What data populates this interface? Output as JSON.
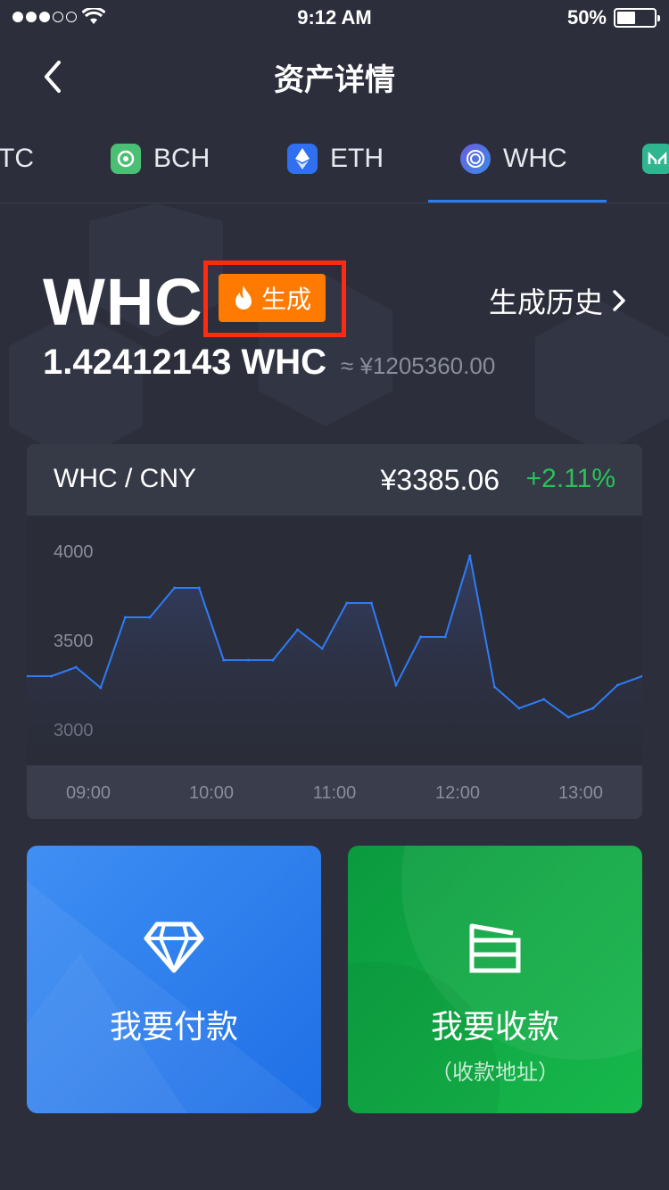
{
  "status_bar": {
    "time": "9:12 AM",
    "battery_percent": "50%",
    "battery_level": 0.5,
    "signal_bars_filled": 3,
    "signal_bars_total": 5
  },
  "nav": {
    "title": "资产详情",
    "back_icon": "chevron-left-icon"
  },
  "coin_tabs": [
    {
      "label": "TC",
      "active": false
    },
    {
      "label": "BCH",
      "active": false,
      "icon": "bch-coin-icon",
      "color": "#4bbf73"
    },
    {
      "label": "ETH",
      "active": false,
      "icon": "eth-coin-icon",
      "color": "#2f6ff0"
    },
    {
      "label": "WHC",
      "active": true,
      "icon": "whc-coin-icon",
      "color": "#4a62d6"
    },
    {
      "label": "",
      "active": false,
      "icon": "mkr-coin-icon",
      "color": "#2fb58f"
    }
  ],
  "asset": {
    "symbol": "WHC",
    "generate_badge": "生成",
    "generate_icon": "flame-icon",
    "generate_history": "生成历史",
    "balance": "1.42412143 WHC",
    "approx_value": "≈ ¥1205360.00"
  },
  "chart_header": {
    "pair": "WHC / CNY",
    "price": "¥3385.06",
    "change": "+2.11%"
  },
  "chart_data": {
    "type": "area",
    "title": "",
    "xlabel": "",
    "ylabel": "",
    "y_ticks": [
      "4000",
      "3500",
      "3000"
    ],
    "x_ticks": [
      "09:00",
      "10:00",
      "11:00",
      "12:00",
      "13:00"
    ],
    "ylim": [
      2800,
      4200
    ],
    "x": [
      "08:35",
      "08:42",
      "08:48",
      "08:55",
      "09:06",
      "09:18",
      "09:30",
      "09:42",
      "09:54",
      "10:06",
      "10:18",
      "10:30",
      "10:42",
      "10:54",
      "11:06",
      "11:18",
      "11:30",
      "11:42",
      "11:54",
      "12:06",
      "12:18",
      "12:30",
      "12:42",
      "12:54",
      "13:06",
      "13:18",
      "13:30"
    ],
    "series": [
      {
        "values": [
          3300,
          3300,
          3350,
          3235,
          3630,
          3630,
          3795,
          3795,
          3390,
          3390,
          3390,
          3560,
          3455,
          3710,
          3710,
          3250,
          3520,
          3520,
          3975,
          3240,
          3120,
          3170,
          3070,
          3120,
          3250,
          3300
        ]
      }
    ],
    "grid": false,
    "line_color": "#2f7cf6"
  },
  "actions": {
    "pay": {
      "label": "我要付款",
      "icon": "diamond-icon"
    },
    "receive": {
      "label": "我要收款",
      "sub_label": "（收款地址）",
      "icon": "receive-box-icon"
    }
  }
}
